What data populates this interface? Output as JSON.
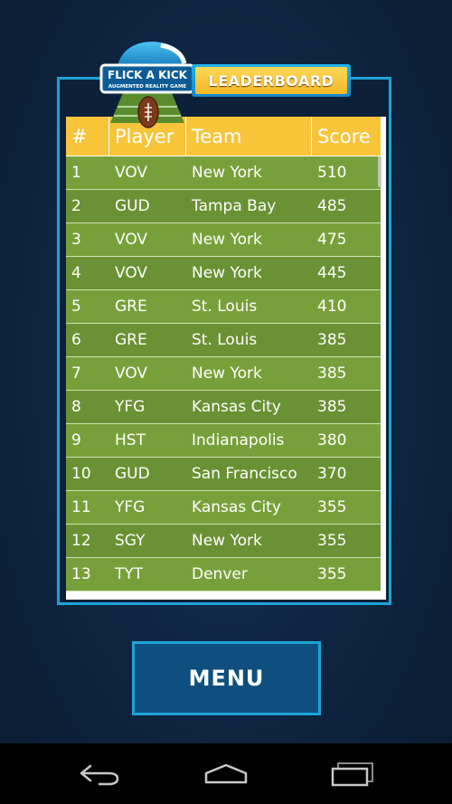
{
  "app": {
    "logo_text": "FLICK A KICK",
    "logo_subtitle": "AUGMENTED REALITY GAME",
    "banner": "LEADERBOARD"
  },
  "table": {
    "headers": {
      "rank": "#",
      "player": "Player",
      "team": "Team",
      "score": "Score"
    },
    "rows": [
      {
        "rank": "1",
        "player": "VOV",
        "team": "New York",
        "score": "510"
      },
      {
        "rank": "2",
        "player": "GUD",
        "team": "Tampa Bay",
        "score": "485"
      },
      {
        "rank": "3",
        "player": "VOV",
        "team": "New York",
        "score": "475"
      },
      {
        "rank": "4",
        "player": "VOV",
        "team": "New York",
        "score": "445"
      },
      {
        "rank": "5",
        "player": "GRE",
        "team": "St. Louis",
        "score": "410"
      },
      {
        "rank": "6",
        "player": "GRE",
        "team": "St. Louis",
        "score": "385"
      },
      {
        "rank": "7",
        "player": "VOV",
        "team": "New York",
        "score": "385"
      },
      {
        "rank": "8",
        "player": "YFG",
        "team": "Kansas City",
        "score": "385"
      },
      {
        "rank": "9",
        "player": "HST",
        "team": "Indianapolis",
        "score": "380"
      },
      {
        "rank": "10",
        "player": "GUD",
        "team": "San Francisco",
        "score": "370"
      },
      {
        "rank": "11",
        "player": "YFG",
        "team": "Kansas City",
        "score": "355"
      },
      {
        "rank": "12",
        "player": "SGY",
        "team": "New York",
        "score": "355"
      },
      {
        "rank": "13",
        "player": "TYT",
        "team": "Denver",
        "score": "355"
      }
    ]
  },
  "menu_button": "MENU",
  "colors": {
    "header_yellow": "#f8c43a",
    "row_green_light": "#78a03a",
    "row_green_dark": "#6a9133",
    "accent_blue": "#1fa3d6",
    "button_blue": "#0f4f7f"
  },
  "icons": {
    "back": "back-arrow-icon",
    "home": "home-icon",
    "recents": "recent-apps-icon"
  }
}
